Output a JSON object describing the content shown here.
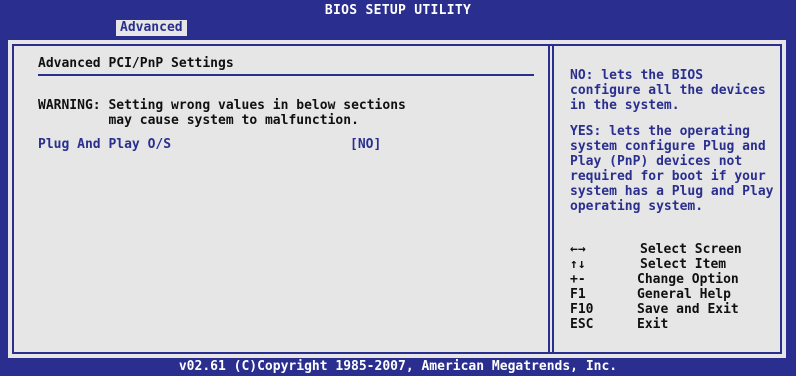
{
  "header": {
    "title": "BIOS SETUP UTILITY",
    "active_tab": "Advanced"
  },
  "main": {
    "section_title": "Advanced PCI/PnP Settings",
    "warning_line1": "WARNING: Setting wrong values in below sections",
    "warning_line2": "         may cause system to malfunction.",
    "option": {
      "label": "Plug And Play O/S",
      "value": "[NO]"
    }
  },
  "help": {
    "text1": "NO: lets the BIOS configure all the devices in the system.",
    "text2": "YES: lets the operating system configure Plug and Play (PnP) devices not required for boot if your system has a Plug and Play operating system."
  },
  "keys": [
    {
      "symbol": "←→",
      "desc": "Select Screen"
    },
    {
      "symbol": "↑↓",
      "desc": "Select Item"
    },
    {
      "symbol": "+-",
      "desc": "Change Option"
    },
    {
      "symbol": "F1",
      "desc": "General Help"
    },
    {
      "symbol": "F10",
      "desc": "Save and Exit"
    },
    {
      "symbol": "ESC",
      "desc": "Exit"
    }
  ],
  "footer": {
    "copyright": "v02.61 (C)Copyright 1985-2007, American Megatrends, Inc."
  },
  "colors": {
    "bios_blue": "#2a2f8f",
    "panel_gray": "#e6e6e6",
    "text_dark": "#101010"
  }
}
